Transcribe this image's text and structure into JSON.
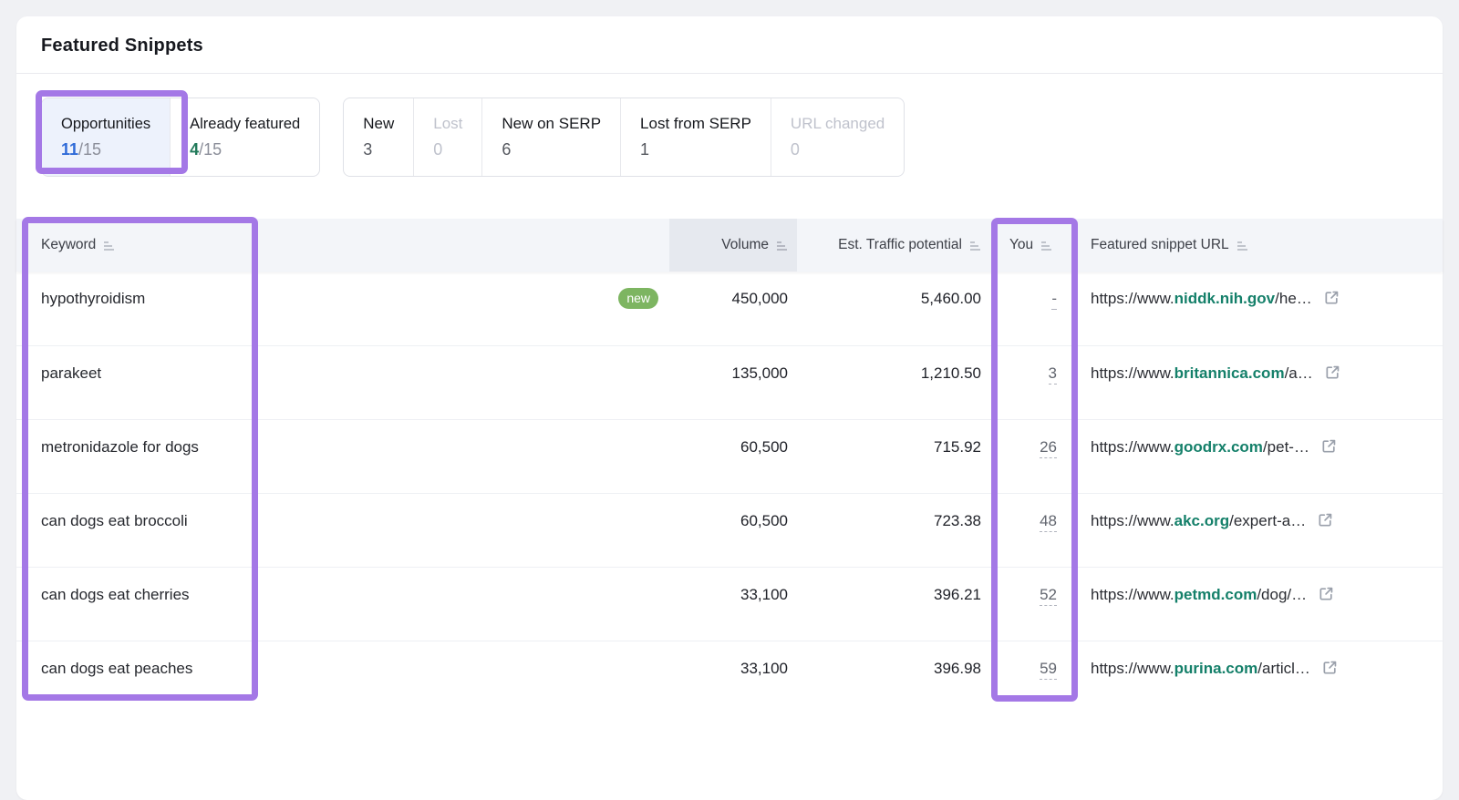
{
  "title": "Featured Snippets",
  "tabs": {
    "opportunities": {
      "label": "Opportunities",
      "value": "11",
      "total": "/15"
    },
    "already_featured": {
      "label": "Already featured",
      "value": "4",
      "total": "/15"
    }
  },
  "filters": [
    {
      "label": "New",
      "value": "3",
      "disabled": false
    },
    {
      "label": "Lost",
      "value": "0",
      "disabled": true
    },
    {
      "label": "New on SERP",
      "value": "6",
      "disabled": false
    },
    {
      "label": "Lost from SERP",
      "value": "1",
      "disabled": false
    },
    {
      "label": "URL changed",
      "value": "0",
      "disabled": true
    }
  ],
  "table": {
    "columns": [
      "Keyword",
      "Volume",
      "Est. Traffic potential",
      "You",
      "Featured snippet URL"
    ],
    "rows": [
      {
        "keyword": "hypothyroidism",
        "badge": "new",
        "volume": "450,000",
        "etp": "5,460.00",
        "you": "-",
        "url_prefix": "https://www.",
        "url_domain": "niddk.nih.gov",
        "url_path": "/he…"
      },
      {
        "keyword": "parakeet",
        "volume": "135,000",
        "etp": "1,210.50",
        "you": "3",
        "url_prefix": "https://www.",
        "url_domain": "britannica.com",
        "url_path": "/a…"
      },
      {
        "keyword": "metronidazole for dogs",
        "volume": "60,500",
        "etp": "715.92",
        "you": "26",
        "url_prefix": "https://www.",
        "url_domain": "goodrx.com",
        "url_path": "/pet-…"
      },
      {
        "keyword": "can dogs eat broccoli",
        "volume": "60,500",
        "etp": "723.38",
        "you": "48",
        "url_prefix": "https://www.",
        "url_domain": "akc.org",
        "url_path": "/expert-a…"
      },
      {
        "keyword": "can dogs eat cherries",
        "volume": "33,100",
        "etp": "396.21",
        "you": "52",
        "url_prefix": "https://www.",
        "url_domain": "petmd.com",
        "url_path": "/dog/…"
      },
      {
        "keyword": "can dogs eat peaches",
        "volume": "33,100",
        "etp": "396.98",
        "you": "59",
        "url_prefix": "https://www.",
        "url_domain": "purina.com",
        "url_path": "/articl…"
      }
    ]
  },
  "colors": {
    "annotation_purple": "#a478e6",
    "badge_green": "#7db561",
    "domain_link_green": "#15806a",
    "active_tab_blue": "#2f6bd8",
    "featured_green": "#217a5a",
    "active_tab_bg": "#edf2fc",
    "header_bg": "#f3f5f9",
    "sorted_col_bg": "#e6e9ef"
  }
}
